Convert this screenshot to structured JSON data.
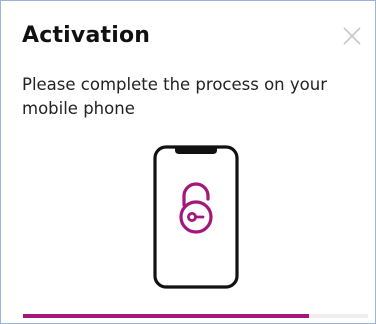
{
  "dialog": {
    "title": "Activation",
    "close_icon": "close-icon",
    "message": "Please complete the process on your mobile phone",
    "illustration_icon": "phone-unlock-icon",
    "progress_fraction": 0.83
  },
  "colors": {
    "accent": "#a4177a",
    "title_text": "#111111",
    "body_text": "#222222",
    "border": "#9ab3d9",
    "track": "#eeeeee"
  }
}
